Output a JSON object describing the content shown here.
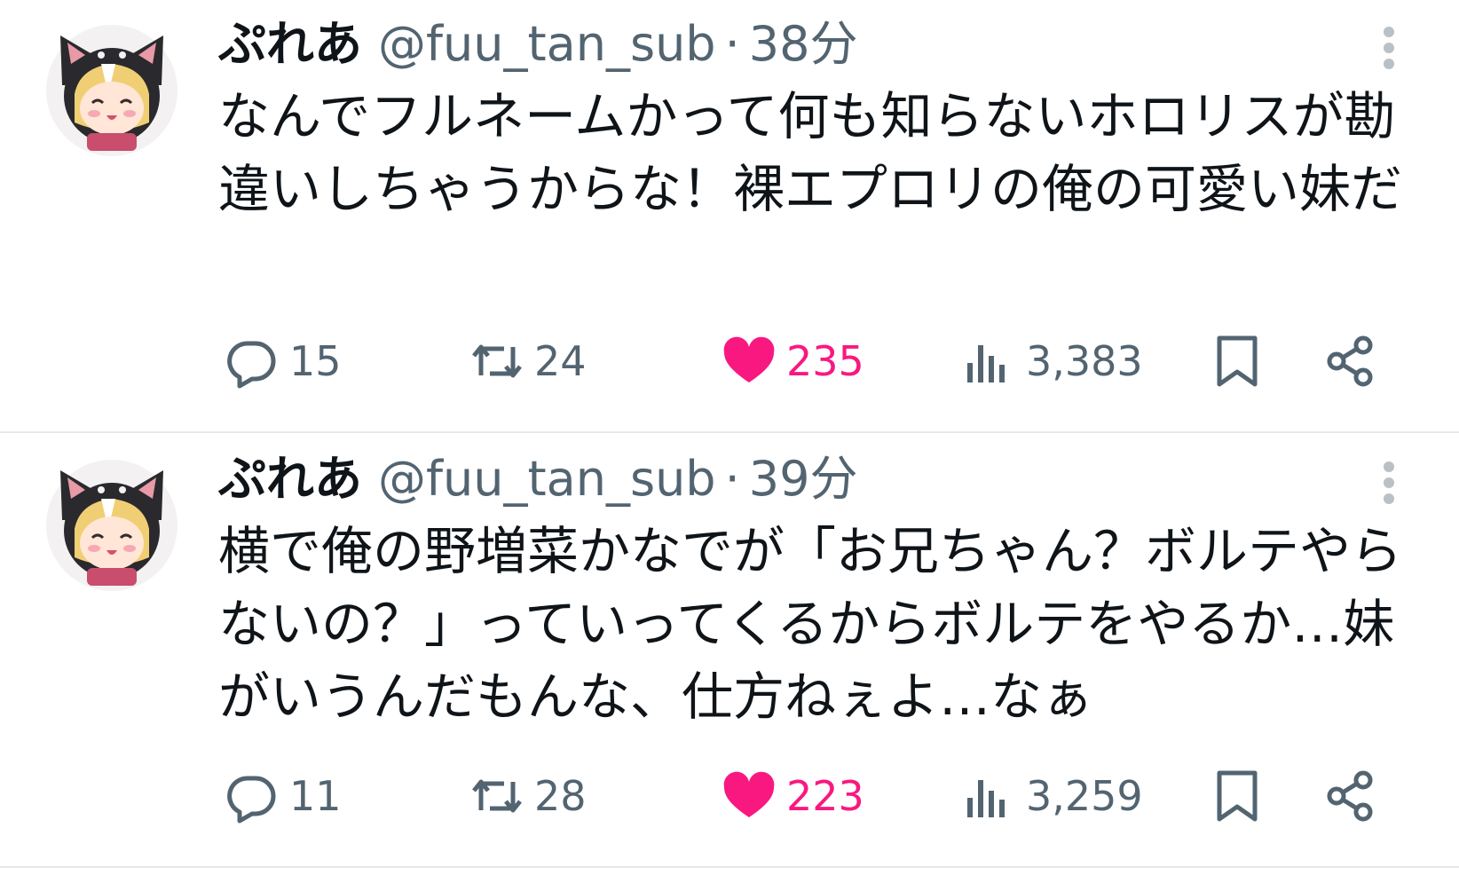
{
  "colors": {
    "text": "#0f1419",
    "muted": "#536471",
    "like": "#f91880",
    "divider": "#e6e9ec"
  },
  "tweets": [
    {
      "display_name": "ぷれあ",
      "handle": "@fuu_tan_sub",
      "separator": "·",
      "time": "38分",
      "text": "なんでフルネームかって何も知らないホロリスが勘違いしちゃうからな！裸エプロリの俺の可愛い妹だ",
      "replies": "15",
      "retweets": "24",
      "likes": "235",
      "views": "3,383",
      "liked": true
    },
    {
      "display_name": "ぷれあ",
      "handle": "@fuu_tan_sub",
      "separator": "·",
      "time": "39分",
      "text": "横で俺の野増菜かなでが「お兄ちゃん？ボルテやらないの？」っていってくるからボルテをやるか…妹がいうんだもんな、仕方ねぇよ…なぁ",
      "replies": "11",
      "retweets": "28",
      "likes": "223",
      "views": "3,259",
      "liked": true
    }
  ],
  "icons": {
    "avatar": "cat-hood-anime-avatar",
    "more": "more-vertical-icon",
    "reply": "reply-bubble-icon",
    "retweet": "retweet-arrows-icon",
    "like": "heart-filled-icon",
    "views": "views-bar-chart-icon",
    "bookmark": "bookmark-icon",
    "share": "share-icon"
  }
}
